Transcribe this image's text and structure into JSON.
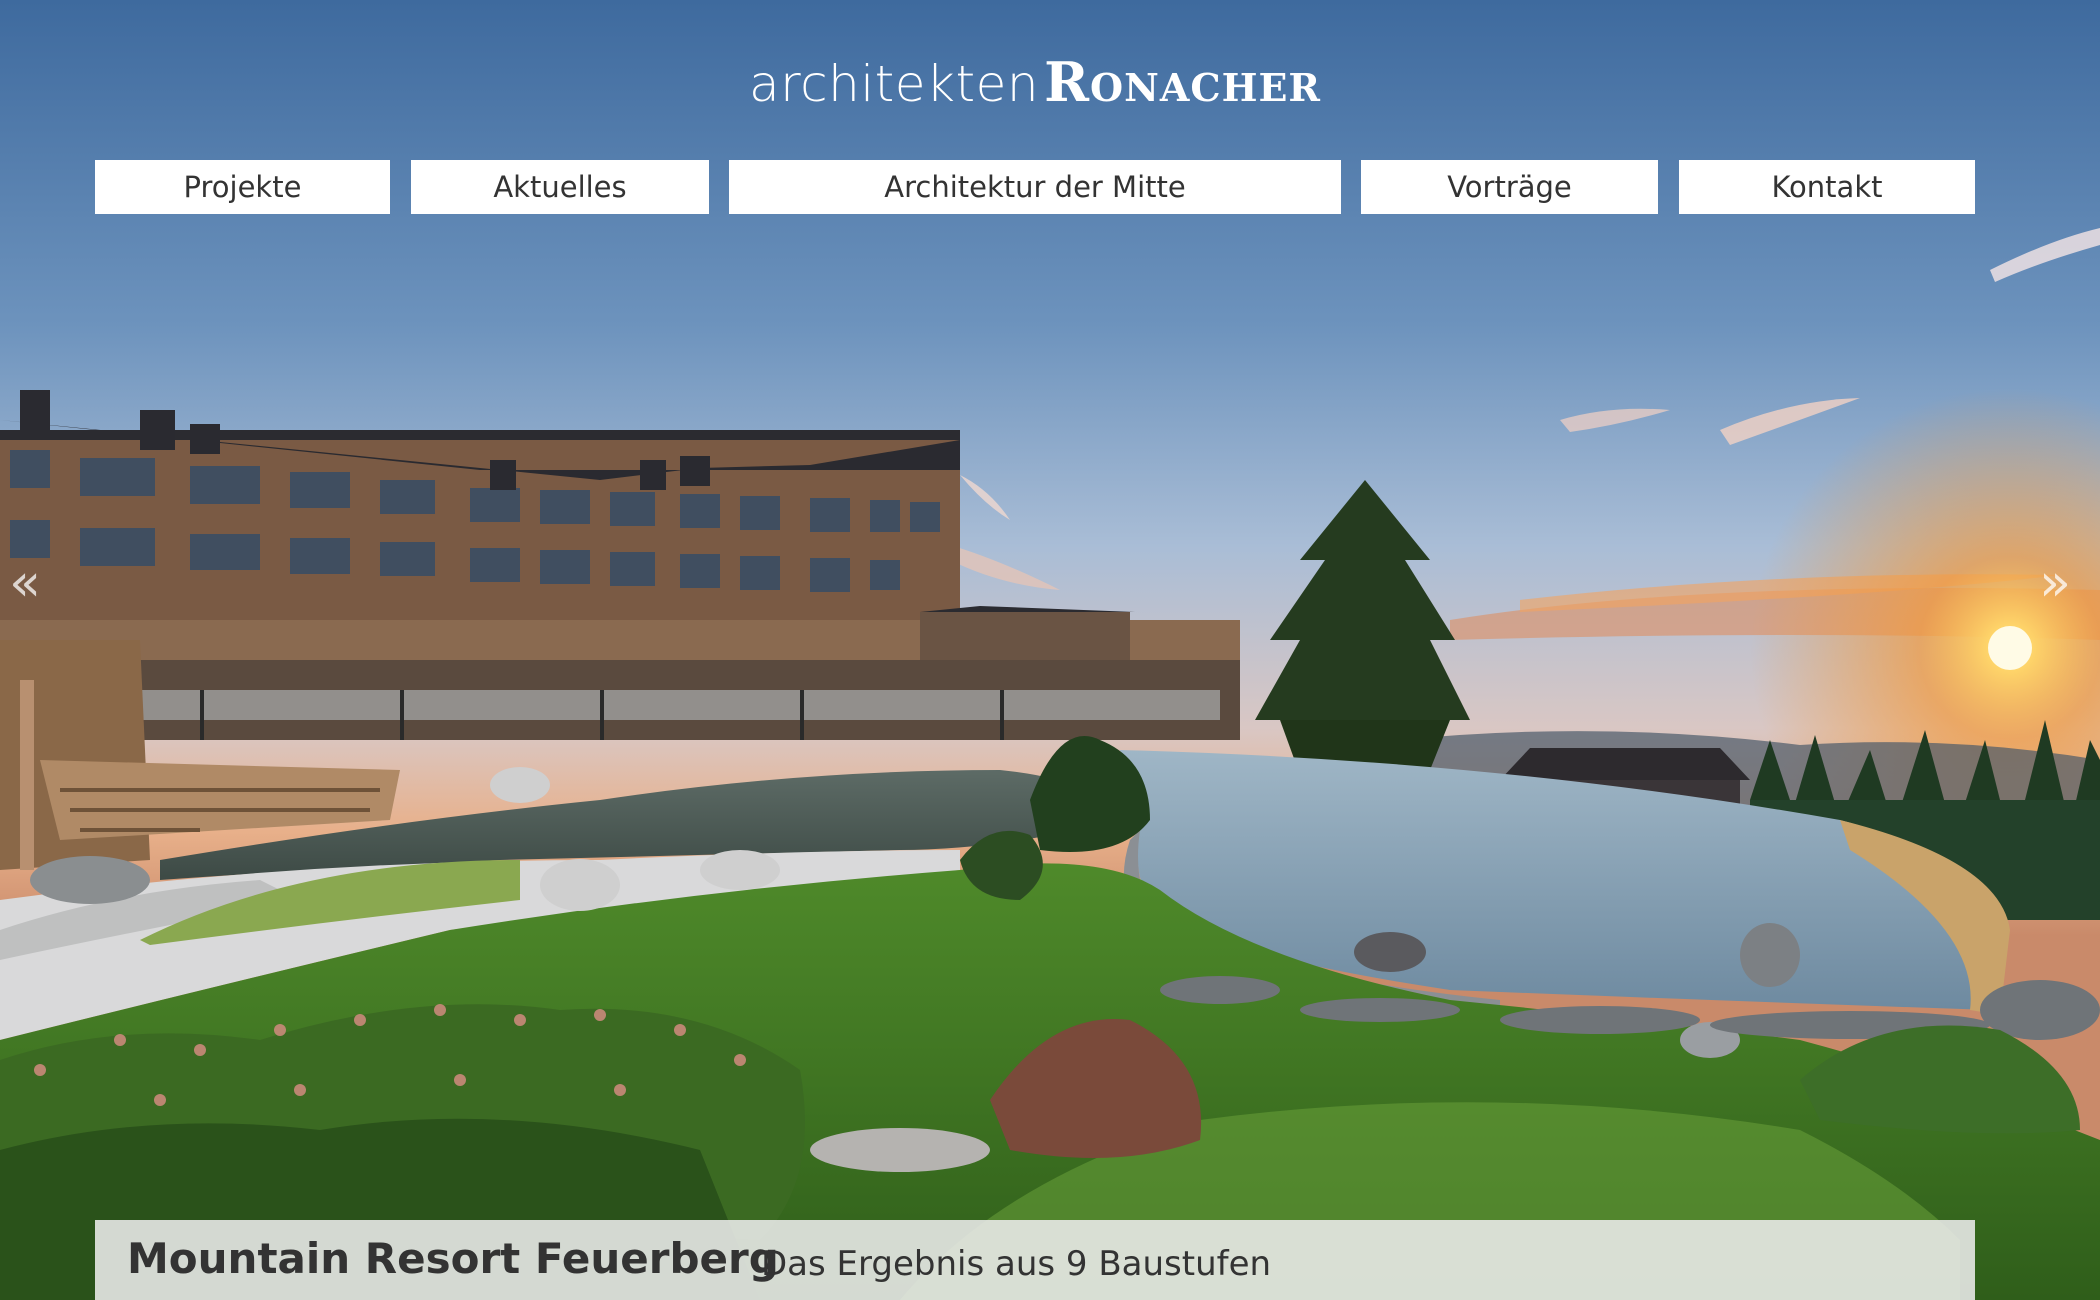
{
  "header": {
    "logo_prefix": "architekten",
    "logo_name": "Ronacher"
  },
  "nav": {
    "items": [
      {
        "label": "Projekte"
      },
      {
        "label": "Aktuelles"
      },
      {
        "label": "Architektur der Mitte"
      },
      {
        "label": "Vorträge"
      },
      {
        "label": "Kontakt"
      }
    ]
  },
  "slider": {
    "prev_icon": "chevron-double-left",
    "next_icon": "chevron-double-right",
    "caption_title": "Mountain Resort Feuerberg",
    "caption_subtitle": "Das Ergebnis aus 9 Baustufen"
  },
  "colors": {
    "nav_bg": "#ffffff",
    "nav_text": "#333333",
    "caption_bg": "#ececec",
    "logo_text": "#ffffff"
  }
}
